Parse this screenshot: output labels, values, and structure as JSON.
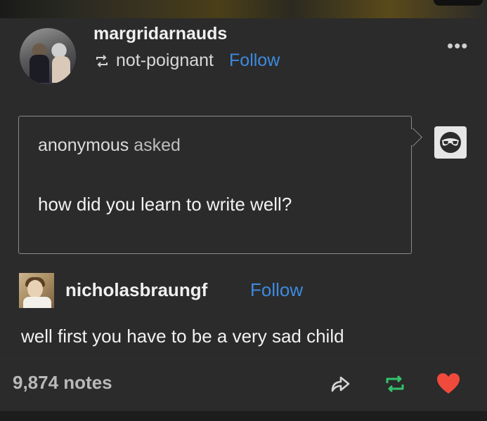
{
  "post": {
    "author": "margridarnauds",
    "reblogged_from": "not-poignant",
    "follow_label": "Follow",
    "more_label": "•••"
  },
  "ask": {
    "asker": "anonymous",
    "asked_word": "asked",
    "question": "how did you learn to write well?"
  },
  "reply": {
    "username": "nicholasbraungf",
    "follow_label": "Follow",
    "text": "well first you have to be a very sad child"
  },
  "footer": {
    "notes": "9,874 notes"
  },
  "icons": {
    "reblog": "reblog-icon",
    "share": "share-icon",
    "like": "heart-icon",
    "more": "more-icon"
  },
  "colors": {
    "background": "#2b2b2b",
    "link": "#3d8ae0",
    "reblog_green": "#33c36b",
    "like_red": "#f04a3c"
  }
}
